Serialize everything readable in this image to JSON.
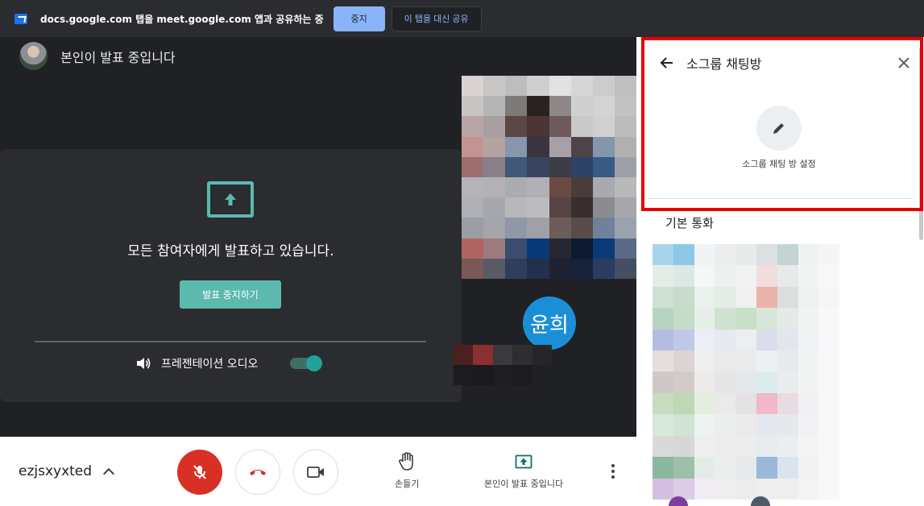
{
  "sharebar": {
    "message": "docs.google.com 탭을 meet.google.com 앱과 공유하는 중",
    "stop_label": "중지",
    "share_instead_label": "이 탭을 대신 공유"
  },
  "stage": {
    "presenter_text": "본인이 발표 중입니다",
    "present_card": {
      "message": "모든 참여자에게 발표하고 있습니다.",
      "stop_button": "발표 중지하기",
      "audio_label": "프레젠테이션 오디오",
      "audio_on": true
    },
    "participant_initials": "윤희"
  },
  "controls": {
    "meeting_code": "ezjsxyxted",
    "hand_label": "손들기",
    "presenting_label": "본인이 발표 중입니다"
  },
  "panel": {
    "title": "소그룹 채팅방",
    "edit_label": "소그룹 채팅 방 설정",
    "group_title": "기본 통화"
  },
  "colors": {
    "accent_teal": "#5bb9ae",
    "mic_off_red": "#d93025",
    "highlight_red": "#e60000",
    "avatar_blue": "#1a8fd8"
  }
}
